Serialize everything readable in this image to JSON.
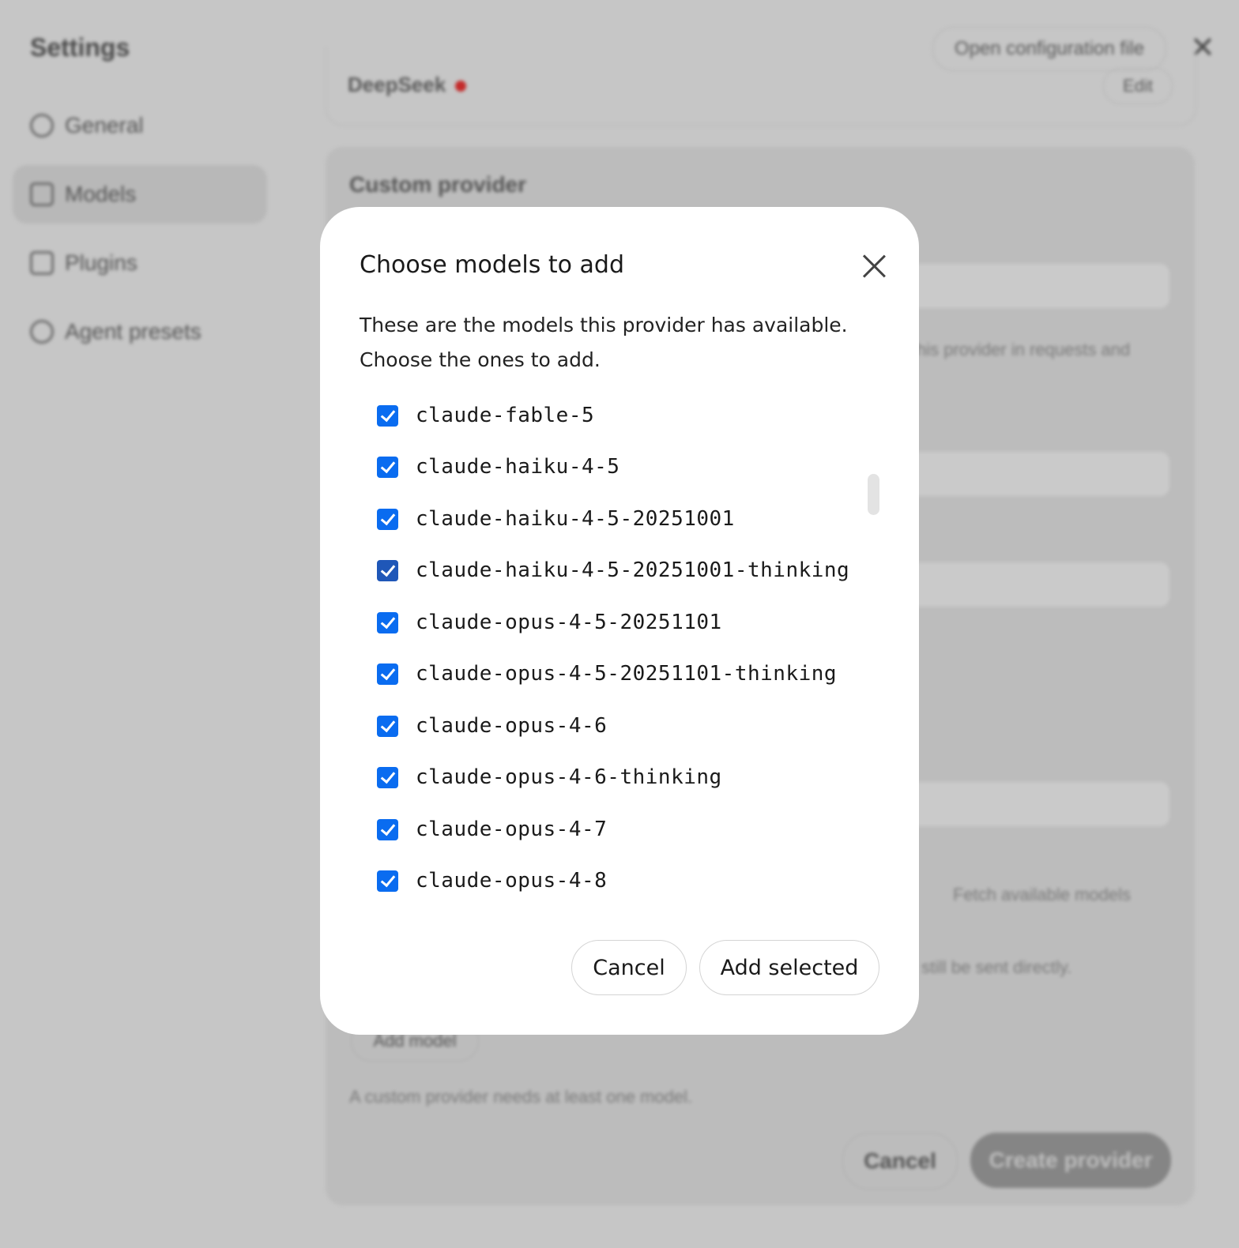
{
  "app": {
    "title": "Settings",
    "open_config_label": "Open configuration file",
    "close_symbol": "✕",
    "nav": [
      {
        "label": "General",
        "icon": "gear-icon"
      },
      {
        "label": "Models",
        "icon": "models-icon"
      },
      {
        "label": "Plugins",
        "icon": "plugins-icon"
      },
      {
        "label": "Agent presets",
        "icon": "agent-icon"
      }
    ],
    "provider_name": "DeepSeek",
    "edit_label": "Edit",
    "custom_provider_title": "Custom provider",
    "visible_fragments": {
      "requests_hint": "his provider in requests and",
      "fetch_models": "Fetch available models",
      "sent_directly": "still be sent directly.",
      "add_model": "Add model",
      "needs_model": "A custom provider needs at least one model."
    },
    "cancel_label": "Cancel",
    "create_provider_label": "Create provider"
  },
  "modal": {
    "title": "Choose models to add",
    "description": "These are the models this provider has available. Choose the ones to add.",
    "models": [
      {
        "name": "claude-fable-5",
        "checked": true
      },
      {
        "name": "claude-haiku-4-5",
        "checked": true
      },
      {
        "name": "claude-haiku-4-5-20251001",
        "checked": true
      },
      {
        "name": "claude-haiku-4-5-20251001-thinking",
        "checked": true
      },
      {
        "name": "claude-opus-4-5-20251101",
        "checked": true
      },
      {
        "name": "claude-opus-4-5-20251101-thinking",
        "checked": true
      },
      {
        "name": "claude-opus-4-6",
        "checked": true
      },
      {
        "name": "claude-opus-4-6-thinking",
        "checked": true
      },
      {
        "name": "claude-opus-4-7",
        "checked": true
      },
      {
        "name": "claude-opus-4-8",
        "checked": true
      }
    ],
    "cancel_label": "Cancel",
    "add_selected_label": "Add selected"
  },
  "colors": {
    "accent": "#0a6cf0",
    "overlay": "#c6c6c6",
    "modal_bg": "#ffffff"
  }
}
